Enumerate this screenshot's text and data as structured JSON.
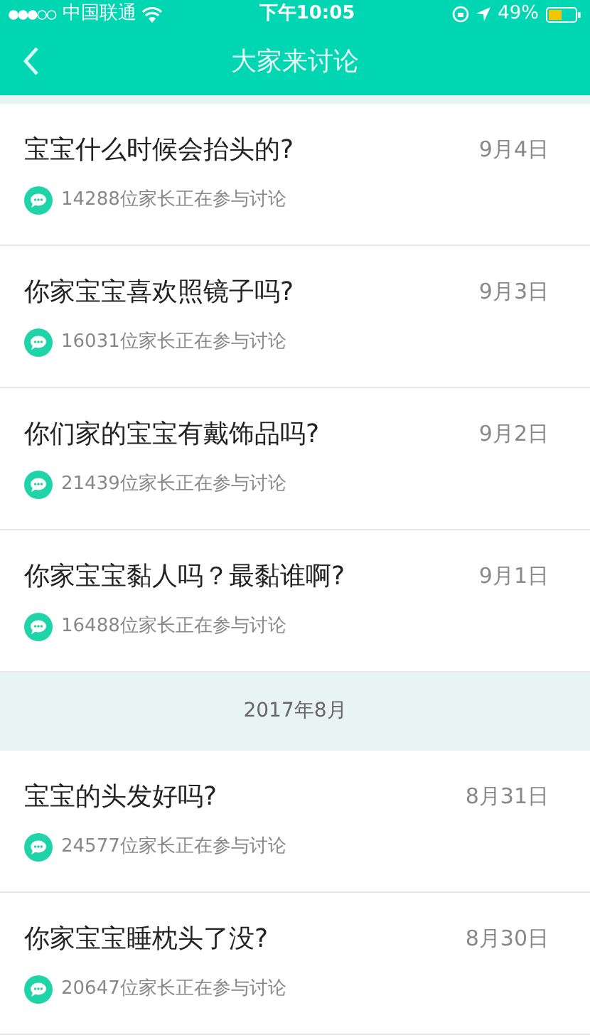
{
  "status_bar": {
    "carrier": "中国联通",
    "time": "下午10:05",
    "battery": "49%"
  },
  "nav": {
    "title": "大家来讨论"
  },
  "groups": [
    {
      "items": [
        {
          "title": "宝宝什么时候会抬头的?",
          "date": "9月4日",
          "participants": "14288位家长正在参与讨论"
        },
        {
          "title": "你家宝宝喜欢照镜子吗?",
          "date": "9月3日",
          "participants": "16031位家长正在参与讨论"
        },
        {
          "title": "你们家的宝宝有戴饰品吗?",
          "date": "9月2日",
          "participants": "21439位家长正在参与讨论"
        },
        {
          "title": "你家宝宝黏人吗？最黏谁啊?",
          "date": "9月1日",
          "participants": "16488位家长正在参与讨论"
        }
      ]
    },
    {
      "header": "2017年8月",
      "items": [
        {
          "title": "宝宝的头发好吗?",
          "date": "8月31日",
          "participants": "24577位家长正在参与讨论"
        },
        {
          "title": "你家宝宝睡枕头了没?",
          "date": "8月30日",
          "participants": "20647位家长正在参与讨论"
        }
      ]
    }
  ]
}
